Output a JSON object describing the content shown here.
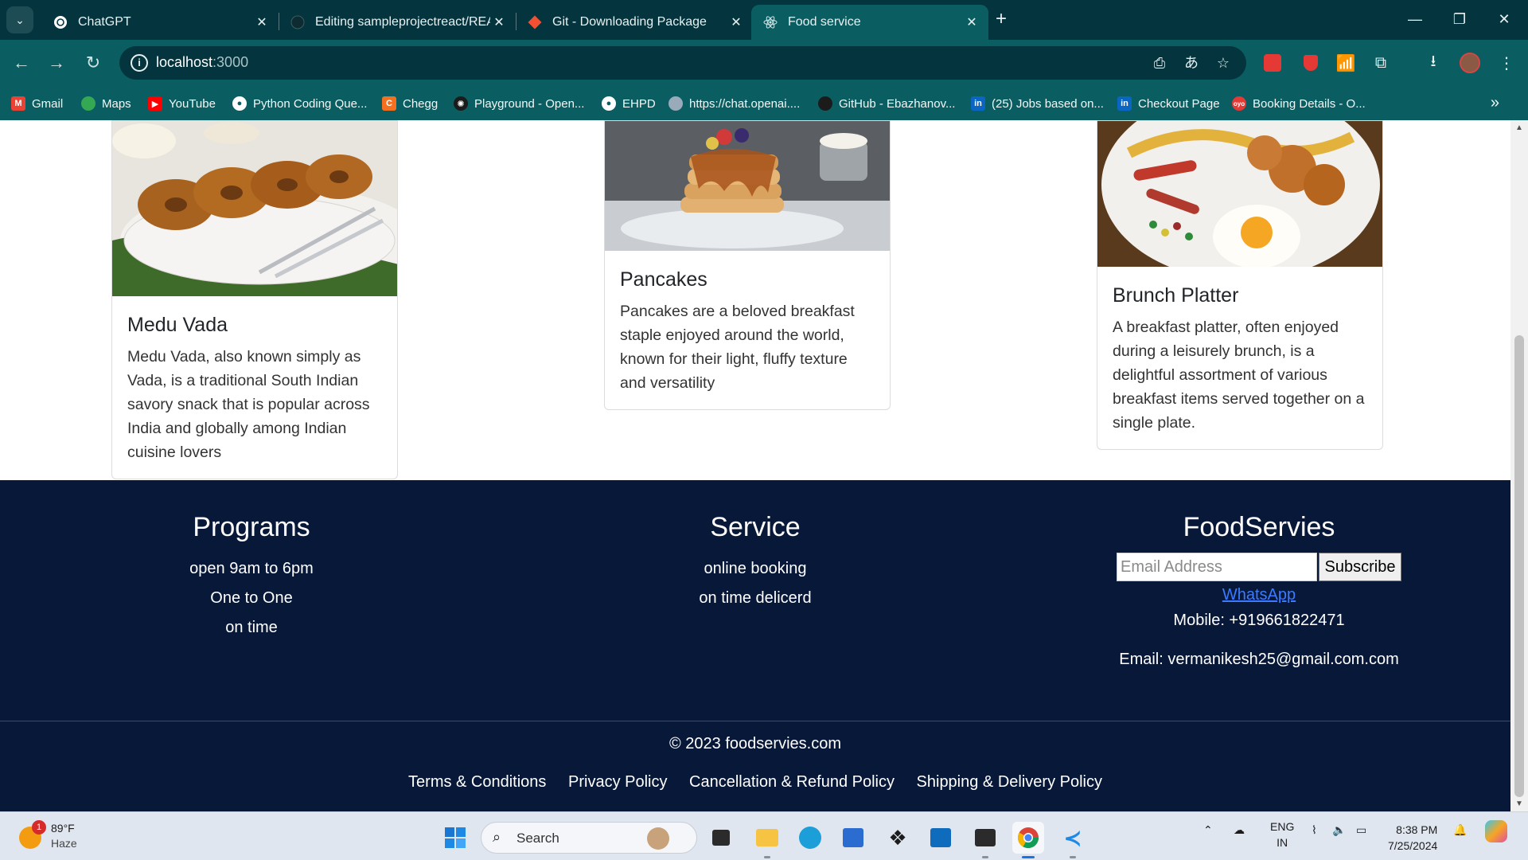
{
  "browser": {
    "tabs": [
      {
        "title": "ChatGPT",
        "active": false
      },
      {
        "title": "Editing sampleprojectreact/REA",
        "active": false
      },
      {
        "title": "Git - Downloading Package",
        "active": false
      },
      {
        "title": "Food service",
        "active": true
      }
    ],
    "url_host": "localhost",
    "url_port": ":3000",
    "bookmarks": [
      "Gmail",
      "Maps",
      "YouTube",
      "Python Coding Que...",
      "Chegg",
      "Playground - Open...",
      "EHPD",
      "https://chat.openai....",
      "GitHub - Ebazhanov...",
      "(25) Jobs based on...",
      "Checkout Page",
      "Booking Details - O..."
    ]
  },
  "cards": [
    {
      "title": "Medu Vada",
      "text": "Medu Vada, also known simply as Vada, is a traditional South Indian savory snack that is popular across India and globally among Indian cuisine lovers"
    },
    {
      "title": "Pancakes",
      "text": "Pancakes are a beloved breakfast staple enjoyed around the world, known for their light, fluffy texture and versatility"
    },
    {
      "title": "Brunch Platter",
      "text": "A breakfast platter, often enjoyed during a leisurely brunch, is a delightful assortment of various breakfast items served together on a single plate."
    }
  ],
  "footer": {
    "programs": {
      "heading": "Programs",
      "lines": [
        "open 9am to 6pm",
        "One to One",
        "on time"
      ]
    },
    "service": {
      "heading": "Service",
      "lines": [
        "online booking",
        "on time delicerd"
      ]
    },
    "brand": {
      "heading": "FoodServies",
      "email_placeholder": "Email Address",
      "subscribe_label": "Subscribe",
      "whatsapp_alt": "WhatsApp",
      "mobile": "Mobile: +919661822471",
      "email": "Email: vermanikesh25@gmail.com.com"
    },
    "copyright": "© 2023 foodservies.com",
    "policies": [
      "Terms & Conditions",
      "Privacy Policy",
      "Cancellation & Refund Policy",
      "Shipping & Delivery Policy"
    ]
  },
  "taskbar": {
    "weather_badge": "1",
    "temperature": "89°F",
    "condition": "Haze",
    "search_label": "Search",
    "language": "ENG",
    "region": "IN",
    "time": "8:38 PM",
    "date": "7/25/2024"
  },
  "colors": {
    "tabstrip": "#04343d",
    "toolbar": "#0a5e61",
    "footer_bg": "#081838",
    "taskbar": "#dfe6f0"
  }
}
